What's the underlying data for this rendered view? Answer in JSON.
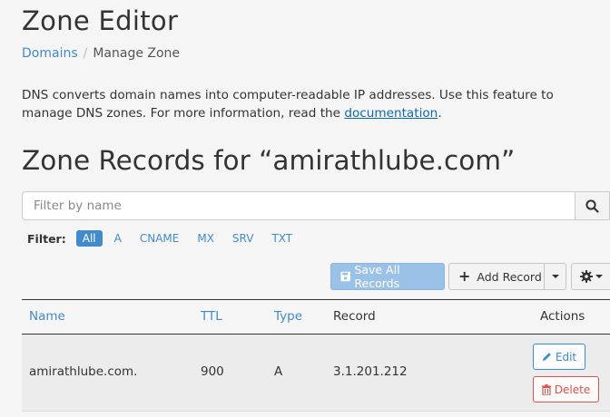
{
  "header": {
    "title": "Zone Editor",
    "breadcrumb": {
      "root": "Domains",
      "separator": "/",
      "current": "Manage Zone"
    }
  },
  "intro": {
    "text": "DNS converts domain names into computer-readable IP addresses. Use this feature to manage DNS zones. For more information, read the ",
    "link": "documentation",
    "suffix": "."
  },
  "section": {
    "title": "Zone Records for “amirathlube.com”"
  },
  "search": {
    "placeholder": "Filter by name",
    "value": ""
  },
  "filter": {
    "label": "Filter:",
    "options": [
      "All",
      "A",
      "CNAME",
      "MX",
      "SRV",
      "TXT"
    ],
    "active": "All"
  },
  "toolbar": {
    "save_label": "Save All Records",
    "add_label": "Add Record"
  },
  "table": {
    "columns": [
      "Name",
      "TTL",
      "Type",
      "Record",
      "Actions"
    ],
    "rows": [
      {
        "name": "amirathlube.com.",
        "ttl": "900",
        "type": "A",
        "record": "3.1.201.212",
        "edit_label": "Edit",
        "delete_label": "Delete"
      }
    ]
  },
  "colors": {
    "accent": "#428bca",
    "danger": "#d9534f",
    "save_disabled": "#9bc2e6"
  }
}
